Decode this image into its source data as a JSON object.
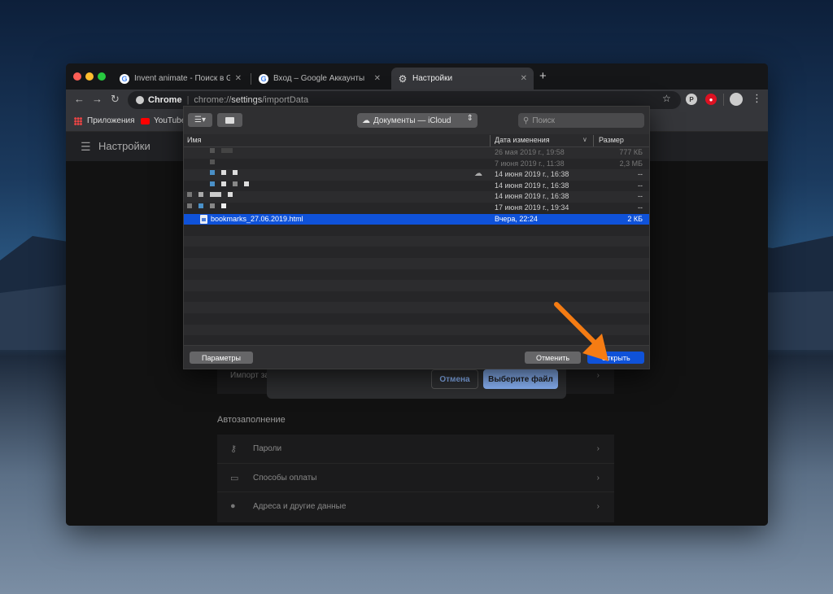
{
  "colors": {
    "accent": "#0f52d9",
    "selection": "#0f52d9",
    "chrome_accent": "#8ab4f8",
    "arrow": "#f57c13"
  },
  "tabs": [
    {
      "label": "Invent animate - Поиск в Google",
      "close": "✕",
      "icon": "google-icon"
    },
    {
      "label": "Вход – Google Аккаунты",
      "close": "✕",
      "icon": "google-icon"
    },
    {
      "label": "Настройки",
      "close": "✕",
      "icon": "gear-icon",
      "active": true
    }
  ],
  "toolbar": {
    "omni_chrome": "Chrome",
    "url_prefix": "chrome://",
    "url_host": "settings",
    "url_path": "/importData"
  },
  "bookmarks": [
    {
      "label": "Приложения",
      "icon": "apps-icon"
    },
    {
      "label": "YouTube",
      "icon": "youtube-icon"
    }
  ],
  "settings": {
    "title": "Настройки",
    "import_row_label": "Импорт за",
    "autofill_title": "Автозаполнение",
    "autofill_items": [
      {
        "label": "Пароли",
        "icon": "key-icon"
      },
      {
        "label": "Способы оплаты",
        "icon": "credit-card-icon"
      },
      {
        "label": "Адреса и другие данные",
        "icon": "location-pin-icon"
      }
    ],
    "import_dialog": {
      "cancel": "Отмена",
      "choose": "Выберите файл"
    }
  },
  "file_dialog": {
    "location": "Документы — iCloud",
    "search_placeholder": "Поиск",
    "columns": {
      "name": "Имя",
      "modified": "Дата изменения",
      "size": "Размер"
    },
    "files": [
      {
        "name": "",
        "date": "26 мая 2019 г., 19:58",
        "size": "777 КБ",
        "dim": true
      },
      {
        "name": "",
        "date": "7 июня 2019 г., 11:38",
        "size": "2,3 МБ",
        "dim": true
      },
      {
        "name": "",
        "date": "14 июня 2019 г., 16:38",
        "size": "--",
        "cloud": true
      },
      {
        "name": "",
        "date": "14 июня 2019 г., 16:38",
        "size": "--"
      },
      {
        "name": "",
        "date": "14 июня 2019 г., 16:38",
        "size": "--"
      },
      {
        "name": "",
        "date": "17 июня 2019 г., 19:34",
        "size": "--"
      },
      {
        "name": "bookmarks_27.06.2019.html",
        "date": "Вчера, 22:24",
        "size": "2 КБ",
        "selected": true
      }
    ],
    "footer": {
      "options": "Параметры",
      "cancel": "Отменить",
      "open": "Открыть"
    }
  }
}
